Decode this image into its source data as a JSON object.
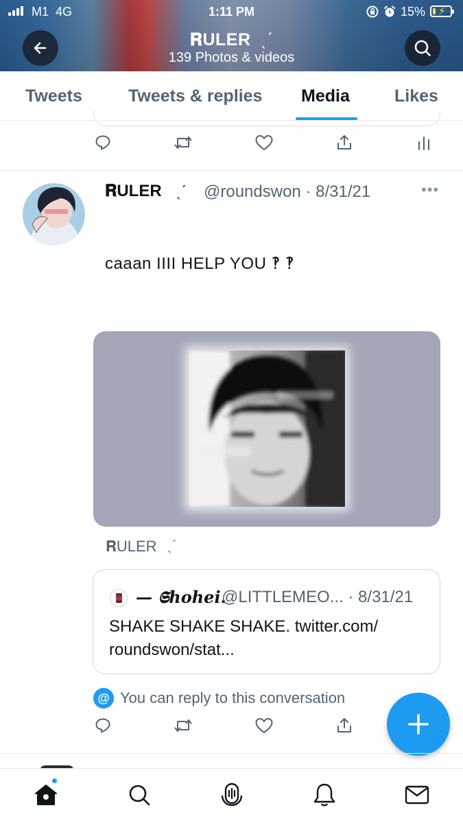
{
  "status_bar": {
    "carrier": "M1",
    "network": "4G",
    "time": "1:11 PM",
    "battery_percent": "15%",
    "battery_level": 0.15
  },
  "header": {
    "title": "𝐑ULER",
    "title_mark": "ˎˊ",
    "subtitle": "139 Photos & videos"
  },
  "tabs": [
    {
      "label": "Tweets",
      "active": false
    },
    {
      "label": "Tweets & replies",
      "active": false
    },
    {
      "label": "Media",
      "active": true
    },
    {
      "label": "Likes",
      "active": false
    }
  ],
  "tweet": {
    "author_name": "𝐑ULER",
    "author_mark": "ˎˊ",
    "handle_date": "@roundswon · 8/31/21",
    "text": "caaan  IIII  HELP  YOU  ‽ ‽",
    "embed_source_name": "𝐑ULER",
    "embed_source_mark": "ˎˊ",
    "quote": {
      "name": "— 𝕾hohei.",
      "handle_date": "@LITTLEMEO... · 8/31/21",
      "text": "SHAKE SHAKE SHAKE. twitter.com/ roundswon/stat..."
    },
    "reply_note": "You can reply to this conversation"
  },
  "icons": {
    "reply": "reply-icon",
    "retweet": "retweet-icon",
    "like": "like-icon",
    "share": "share-icon",
    "analytics": "analytics-icon",
    "compose": "compose-icon"
  },
  "bottom_nav": [
    "home-icon",
    "search-icon",
    "spaces-icon",
    "notifications-icon",
    "messages-icon"
  ],
  "colors": {
    "accent": "#1d9bf0",
    "secondary_text": "#536471",
    "media_background": "#a3a6b7"
  }
}
